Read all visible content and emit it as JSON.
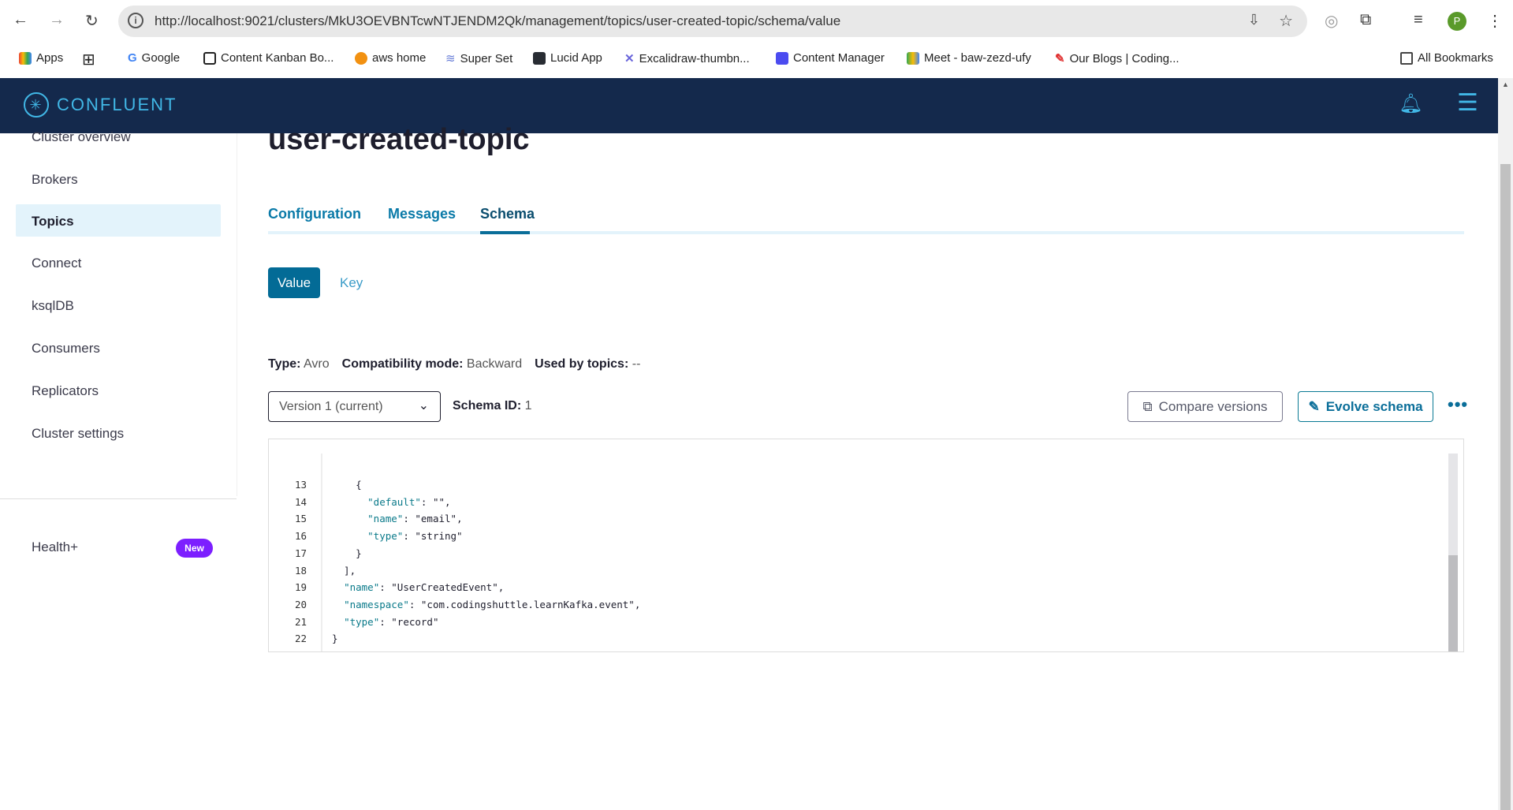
{
  "browser": {
    "url": "http://localhost:9021/clusters/MkU3OEVBNTcwNTJENDM2Qk/management/topics/user-created-topic/schema/value",
    "bookmarks": [
      "Apps",
      "Google",
      "Content Kanban Bo...",
      "aws home",
      "Super Set",
      "Lucid App",
      "Excalidraw-thumbn...",
      "Content Manager",
      "Meet - baw-zezd-ufy",
      "Our Blogs | Coding..."
    ],
    "all_bookmarks": "All Bookmarks",
    "profile_initial": "P"
  },
  "header": {
    "logo": "CONFLUENT"
  },
  "sidebar": {
    "items": [
      "Cluster overview",
      "Brokers",
      "Topics",
      "Connect",
      "ksqlDB",
      "Consumers",
      "Replicators",
      "Cluster settings"
    ],
    "selected": "Topics",
    "health": "Health+",
    "badge": "New"
  },
  "main": {
    "title": "user-created-topic",
    "tabs": [
      "Configuration",
      "Messages",
      "Schema"
    ],
    "active_tab": "Schema",
    "subtabs": [
      "Value",
      "Key"
    ],
    "active_subtab": "Value",
    "meta": {
      "type_label": "Type:",
      "type": "Avro",
      "compat_label": "Compatibility mode:",
      "compat": "Backward",
      "used_label": "Used by topics:",
      "used": "--"
    },
    "version": "Version 1 (current)",
    "schema_id_label": "Schema ID:",
    "schema_id": "1",
    "compare_label": "Compare versions",
    "evolve_label": "Evolve schema",
    "code": [
      {
        "n": "13",
        "t": "    {"
      },
      {
        "n": "14",
        "t": "      \"default\": \"\","
      },
      {
        "n": "15",
        "t": "      \"name\": \"email\","
      },
      {
        "n": "16",
        "t": "      \"type\": \"string\""
      },
      {
        "n": "17",
        "t": "    }"
      },
      {
        "n": "18",
        "t": "  ],"
      },
      {
        "n": "19",
        "t": "  \"name\": \"UserCreatedEvent\","
      },
      {
        "n": "20",
        "t": "  \"namespace\": \"com.codingshuttle.learnKafka.event\","
      },
      {
        "n": "21",
        "t": "  \"type\": \"record\""
      },
      {
        "n": "22",
        "t": "}"
      }
    ]
  },
  "colors": {
    "header": "#14294c",
    "accent": "#036b96",
    "badge": "#7c1fff"
  }
}
